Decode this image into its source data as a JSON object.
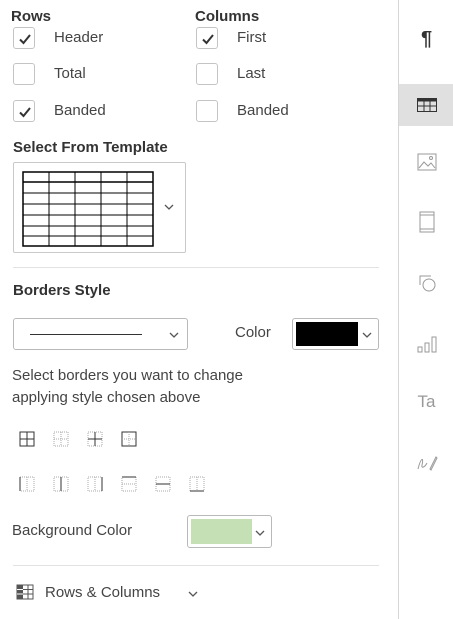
{
  "rows": {
    "heading": "Rows",
    "header": {
      "label": "Header",
      "checked": true
    },
    "total": {
      "label": "Total",
      "checked": false
    },
    "banded": {
      "label": "Banded",
      "checked": true
    }
  },
  "columns": {
    "heading": "Columns",
    "first": {
      "label": "First",
      "checked": true
    },
    "last": {
      "label": "Last",
      "checked": false
    },
    "banded": {
      "label": "Banded",
      "checked": false
    }
  },
  "template": {
    "heading": "Select From Template"
  },
  "borders": {
    "heading": "Borders Style",
    "color_label": "Color",
    "color_value": "#000000",
    "instructions_line1": "Select borders you want to change",
    "instructions_line2": "applying style chosen above"
  },
  "background": {
    "label": "Background Color",
    "color_value": "#c5e0b4"
  },
  "footer": {
    "rows_columns_label": "Rows & Columns"
  },
  "sidebar": {
    "items": [
      "paragraph-icon",
      "table-icon",
      "image-icon",
      "header-footer-icon",
      "shape-icon",
      "chart-icon",
      "text-art-icon",
      "signature-icon"
    ]
  }
}
